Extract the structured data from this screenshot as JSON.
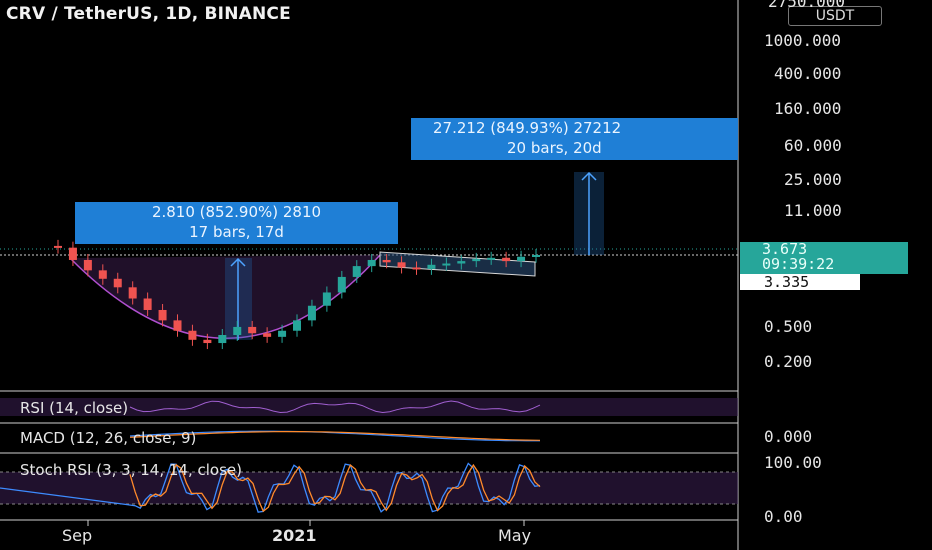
{
  "header": {
    "title": "CRV / TetherUS, 1D, BINANCE",
    "unit_badge": "USDT"
  },
  "price_axis": {
    "ticks": [
      "2750.000",
      "1000.000",
      "400.000",
      "160.000",
      "60.000",
      "25.000",
      "11.000",
      "0.500",
      "0.200"
    ]
  },
  "current_price": {
    "value": "3.673",
    "countdown": "09:39:22",
    "color": "#26a69a"
  },
  "previous_close": {
    "value": "3.335"
  },
  "measure_boxes": [
    {
      "line1": "2.810 (852.90%) 2810",
      "line2": "17 bars, 17d"
    },
    {
      "line1": "27.212 (849.93%) 27212",
      "line2": "20 bars, 20d"
    }
  ],
  "indicators": {
    "rsi": {
      "label": "RSI (14, close)"
    },
    "macd": {
      "label": "MACD (12, 26, close, 9)",
      "axis_tick": "0.000"
    },
    "stoch": {
      "label": "Stoch RSI (3, 3, 14, 14, close)",
      "axis_ticks": [
        "100.00",
        "0.00"
      ]
    }
  },
  "time_axis": {
    "ticks": [
      "Sep",
      "2021",
      "May"
    ]
  },
  "chart_data": {
    "type": "line",
    "title": "CRV / TetherUS, 1D, BINANCE",
    "scale": "log",
    "series": [
      {
        "values": [
          4.5,
          3.2,
          2.4,
          1.9,
          1.5,
          1.1,
          0.8,
          0.6,
          0.45,
          0.35,
          0.32,
          0.4,
          0.5,
          0.42,
          0.38,
          0.45,
          0.6,
          0.9,
          1.3,
          2.0,
          2.7,
          3.2,
          3.0,
          2.6,
          2.5,
          2.8,
          2.9,
          3.1,
          3.3,
          3.4,
          3.1,
          3.5,
          3.673
        ]
      }
    ],
    "ylim": [
      0.15,
      2750
    ],
    "grid": false
  }
}
